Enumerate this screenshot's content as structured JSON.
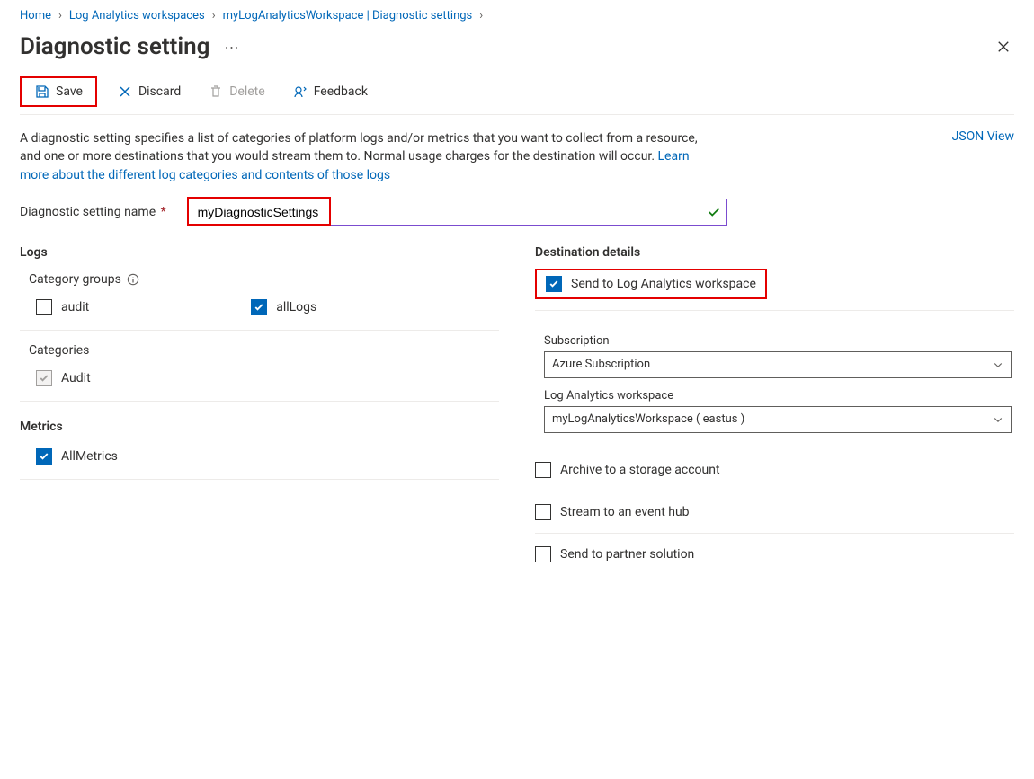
{
  "breadcrumb": {
    "home": "Home",
    "workspaces": "Log Analytics workspaces",
    "workspace_settings": "myLogAnalyticsWorkspace | Diagnostic settings"
  },
  "title": "Diagnostic setting",
  "toolbar": {
    "save_label": "Save",
    "discard_label": "Discard",
    "delete_label": "Delete",
    "feedback_label": "Feedback"
  },
  "description": {
    "text": "A diagnostic setting specifies a list of categories of platform logs and/or metrics that you want to collect from a resource, and one or more destinations that you would stream them to. Normal usage charges for the destination will occur.",
    "link_text": "Learn more about the different log categories and contents of those logs"
  },
  "json_view": "JSON View",
  "name_field": {
    "label": "Diagnostic setting name",
    "value": "myDiagnosticSettings"
  },
  "logs": {
    "heading": "Logs",
    "category_groups_label": "Category groups",
    "audit_label": "audit",
    "alllogs_label": "allLogs",
    "categories_label": "Categories",
    "category_audit_label": "Audit"
  },
  "metrics": {
    "heading": "Metrics",
    "allmetrics_label": "AllMetrics"
  },
  "destination": {
    "heading": "Destination details",
    "send_la_label": "Send to Log Analytics workspace",
    "subscription_label": "Subscription",
    "subscription_value": "Azure Subscription",
    "workspace_label": "Log Analytics workspace",
    "workspace_value": "myLogAnalyticsWorkspace ( eastus )",
    "archive_label": "Archive to a storage account",
    "stream_label": "Stream to an event hub",
    "partner_label": "Send to partner solution"
  }
}
